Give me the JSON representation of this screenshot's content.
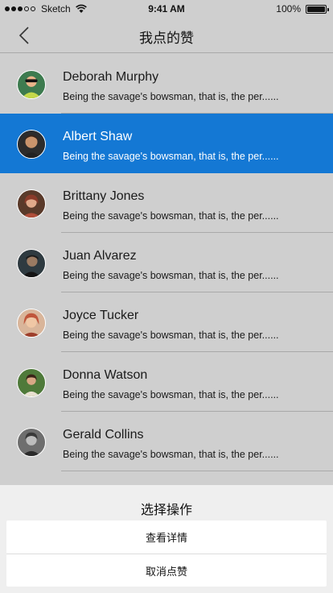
{
  "status_bar": {
    "carrier": "Sketch",
    "time": "9:41 AM",
    "battery": "100%"
  },
  "nav": {
    "title": "我点的赞",
    "back_icon": "chevron-left-icon"
  },
  "items": [
    {
      "name": "Deborah Murphy",
      "message": "Being the savage's bowsman, that is, the per......",
      "avatar_color": "#3d7b4f",
      "selected": false
    },
    {
      "name": "Albert Shaw",
      "message": "Being the savage's bowsman, that is, the per......",
      "avatar_color": "#6b4a3a",
      "selected": true
    },
    {
      "name": "Brittany Jones",
      "message": "Being the savage's bowsman, that is, the per......",
      "avatar_color": "#8a3b2a",
      "selected": false
    },
    {
      "name": "Juan Alvarez",
      "message": "Being the savage's bowsman, that is, the per......",
      "avatar_color": "#2e3a40",
      "selected": false
    },
    {
      "name": "Joyce Tucker",
      "message": "Being the savage's bowsman, that is, the per......",
      "avatar_color": "#c0563b",
      "selected": false
    },
    {
      "name": "Donna Watson",
      "message": "Being the savage's bowsman, that is, the per......",
      "avatar_color": "#4f7a3a",
      "selected": false
    },
    {
      "name": "Gerald Collins",
      "message": "Being the savage's bowsman, that is, the per......",
      "avatar_color": "#5a5a5a",
      "selected": false
    }
  ],
  "action_sheet": {
    "title": "选择操作",
    "options": [
      "查看详情",
      "取消点赞"
    ]
  },
  "colors": {
    "selected_row": "#1478d4",
    "background": "#cfcfcf"
  }
}
